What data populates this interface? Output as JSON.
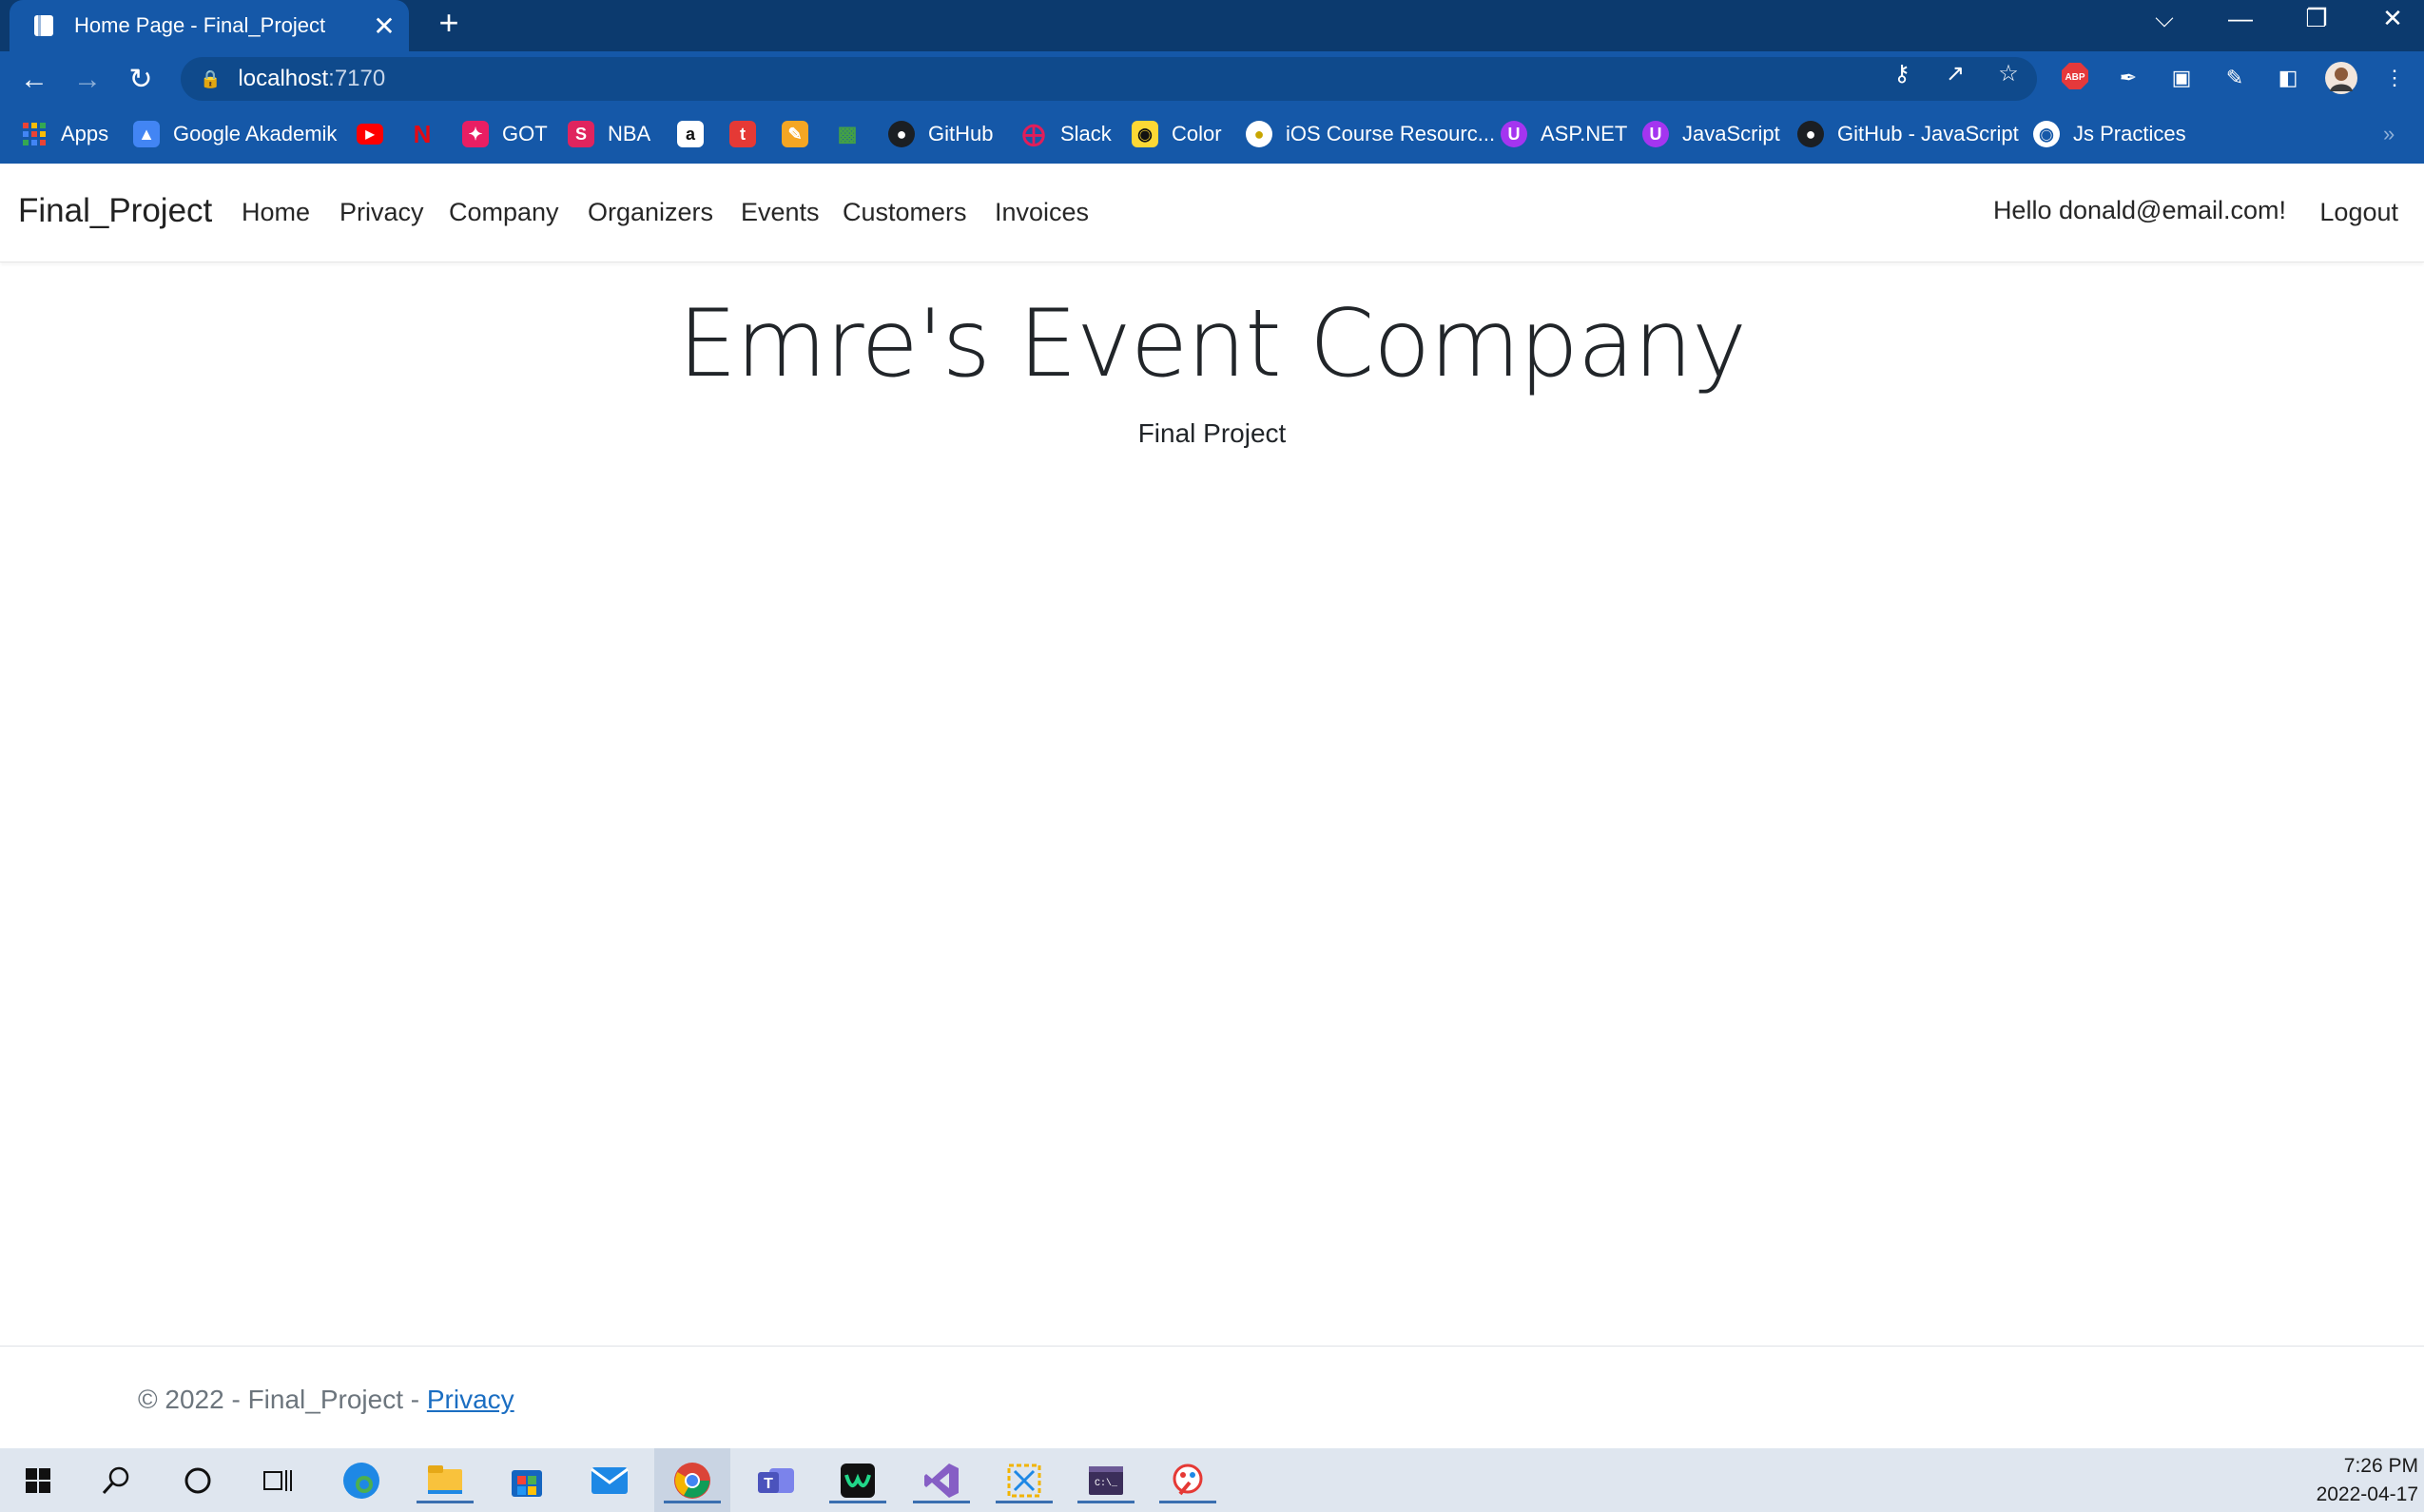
{
  "browser": {
    "tab_title": "Home Page - Final_Project",
    "tab_close": "✕",
    "new_tab": "+",
    "url_host": "localhost",
    "url_port": ":7170",
    "window_controls": [
      "⌵",
      "—",
      "❐",
      "✕"
    ]
  },
  "bookmarks": [
    {
      "label": "Apps",
      "icon": "apps-grid-icon",
      "color": "#e53935"
    },
    {
      "label": "Google Akademik",
      "icon": "graduation-cap-icon",
      "color": "#4285f4"
    },
    {
      "label": "",
      "icon": "youtube-icon",
      "color": "#ff0000"
    },
    {
      "label": "",
      "icon": "netflix-icon",
      "color": "#e50914"
    },
    {
      "label": "GOT",
      "icon": "got-icon",
      "color": "#e91e63"
    },
    {
      "label": "NBA",
      "icon": "nba-icon",
      "color": "#e0245e"
    },
    {
      "label": "",
      "icon": "amazon-icon",
      "color": "#ffffff"
    },
    {
      "label": "",
      "icon": "tumblr-icon",
      "color": "#e53935"
    },
    {
      "label": "",
      "icon": "notes-icon",
      "color": "#f5a623"
    },
    {
      "label": "",
      "icon": "bars-icon",
      "color": "#43a047"
    },
    {
      "label": "GitHub",
      "icon": "github-icon",
      "color": "#1b1f23"
    },
    {
      "label": "Slack",
      "icon": "slack-icon",
      "color": "#4a154b"
    },
    {
      "label": "Color",
      "icon": "color-icon",
      "color": "#fdd835"
    },
    {
      "label": "iOS Course Resourc...",
      "icon": "ios-course-icon",
      "color": "#ffffff"
    },
    {
      "label": "ASP.NET",
      "icon": "udemy-icon",
      "color": "#a435f0"
    },
    {
      "label": "JavaScript",
      "icon": "udemy-icon",
      "color": "#a435f0"
    },
    {
      "label": "GitHub - JavaScript",
      "icon": "github-icon",
      "color": "#1b1f23"
    },
    {
      "label": "Js Practices",
      "icon": "globe-icon",
      "color": "#ffffff"
    }
  ],
  "navbar": {
    "brand": "Final_Project",
    "links": [
      "Home",
      "Privacy",
      "Company",
      "Organizers",
      "Events",
      "Customers",
      "Invoices"
    ],
    "greeting": "Hello donald@email.com!",
    "logout": "Logout"
  },
  "main": {
    "title": "Emre's Event Company",
    "subtitle": "Final Project"
  },
  "footer": {
    "text": "© 2022 - Final_Project - ",
    "privacy_link": "Privacy"
  },
  "taskbar": {
    "time": "7:26 PM",
    "date": "2022-04-17",
    "apps": [
      "start-icon",
      "search-icon",
      "cortana-icon",
      "task-view-icon",
      "edge-icon",
      "file-explorer-icon",
      "store-icon",
      "mail-icon",
      "chrome-icon",
      "teams-icon",
      "webstorm-icon",
      "visual-studio-icon",
      "snip-icon",
      "terminal-icon",
      "paint-icon"
    ]
  },
  "colors": {
    "chrome_dark": "#0c3a6e",
    "chrome": "#1558a8",
    "link": "#1b6ec2"
  }
}
